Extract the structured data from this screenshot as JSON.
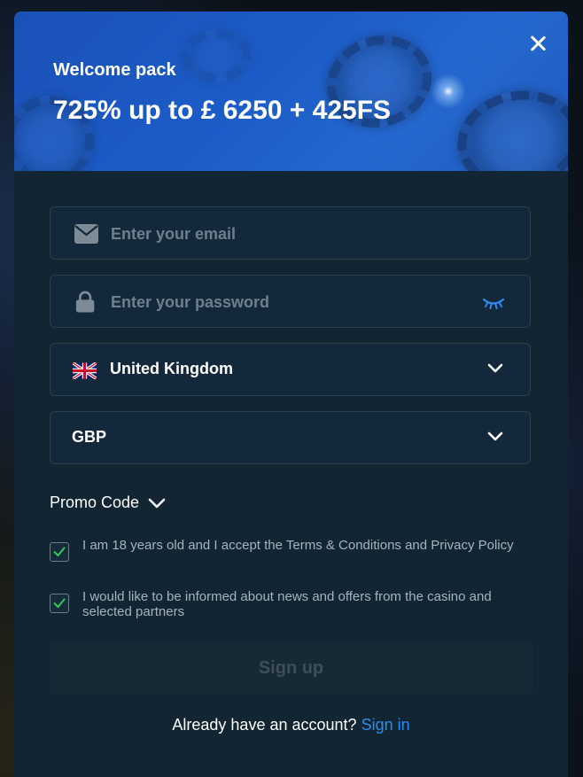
{
  "banner": {
    "subtitle": "Welcome pack",
    "title": "725% up to £ 6250 + 425FS"
  },
  "form": {
    "email": {
      "placeholder": "Enter your email",
      "value": ""
    },
    "password": {
      "placeholder": "Enter your password",
      "value": ""
    },
    "country": {
      "value": "United Kingdom"
    },
    "currency": {
      "value": "GBP"
    }
  },
  "promo": {
    "label": "Promo Code"
  },
  "consents": [
    {
      "text": "I am 18 years old and I accept the Terms & Conditions and Privacy Policy",
      "checked": true
    },
    {
      "text": "I would like to be informed about news and offers from the casino and selected partners",
      "checked": true
    }
  ],
  "signup": {
    "label": "Sign up",
    "enabled": false
  },
  "footer": {
    "question": "Already have an account?",
    "link": "Sign in"
  },
  "icons": {
    "close": "close-icon",
    "email": "envelope-icon",
    "password": "lock-icon",
    "toggle": "eye-closed-icon",
    "flag": "uk-flag-icon",
    "dropdown": "chevron-down-icon",
    "check": "checkmark-icon"
  },
  "colors": {
    "accent": "#2d8cf0",
    "check": "#34c759",
    "panel": "#112532",
    "banner": "#1c5cc7"
  }
}
